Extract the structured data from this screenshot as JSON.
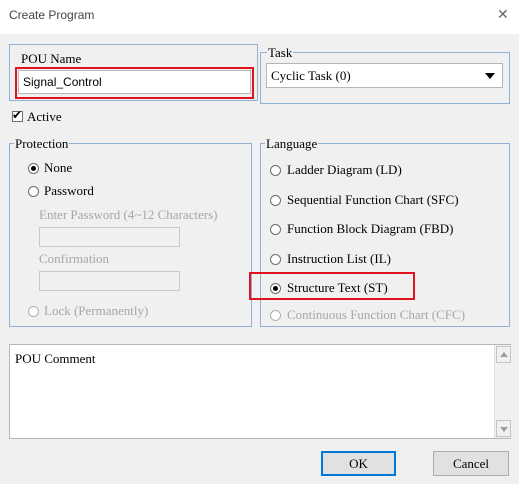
{
  "window": {
    "title": "Create Program"
  },
  "pou": {
    "name_label": "POU Name",
    "name_value": "Signal_Control",
    "active_label": "Active",
    "active_checked": true
  },
  "task": {
    "legend": "Task",
    "selected": "Cyclic Task (0)"
  },
  "protection": {
    "legend": "Protection",
    "options": [
      {
        "label": "None",
        "selected": true,
        "enabled": true
      },
      {
        "label": "Password",
        "selected": false,
        "enabled": true
      },
      {
        "label": "Lock (Permanently)",
        "selected": false,
        "enabled": false
      }
    ],
    "enter_password_label": "Enter Password (4~12 Characters)",
    "confirmation_label": "Confirmation"
  },
  "language": {
    "legend": "Language",
    "options": [
      {
        "label": "Ladder Diagram (LD)",
        "selected": false,
        "enabled": true
      },
      {
        "label": "Sequential Function Chart (SFC)",
        "selected": false,
        "enabled": true
      },
      {
        "label": "Function Block Diagram (FBD)",
        "selected": false,
        "enabled": true
      },
      {
        "label": "Instruction List (IL)",
        "selected": false,
        "enabled": true
      },
      {
        "label": "Structure Text (ST)",
        "selected": true,
        "enabled": true
      },
      {
        "label": "Continuous Function Chart (CFC)",
        "selected": false,
        "enabled": false
      }
    ]
  },
  "comment": {
    "label": "POU Comment"
  },
  "buttons": {
    "ok": "OK",
    "cancel": "Cancel"
  },
  "icons": {
    "close": "close-icon",
    "dropdown": "chevron-down-icon",
    "check": "checkmark-icon"
  },
  "colors": {
    "highlight": "#e0141e",
    "group_border": "#8fb1d6",
    "default_button_border": "#0078d7"
  }
}
